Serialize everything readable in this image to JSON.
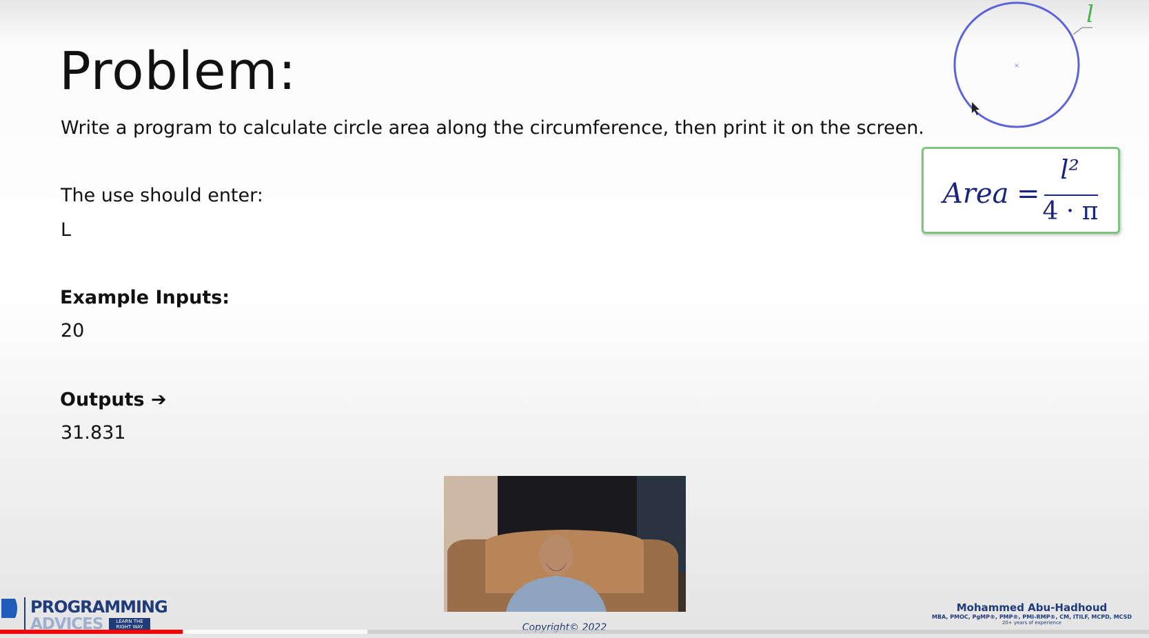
{
  "slide": {
    "title": "Problem:",
    "description": "Write a program to calculate circle area along the circumference, then print it on the screen.",
    "prompt_label": "The use should enter:",
    "prompt_value": "L",
    "example_label": "Example Inputs:",
    "example_value": "20",
    "outputs_label": "Outputs ➔",
    "outputs_value": "31.831"
  },
  "figure": {
    "circle_label": "l",
    "formula_lhs": "Area",
    "formula_eq": "=",
    "formula_num": "l²",
    "formula_den": "4 · π",
    "circle_color": "#5b63d9",
    "label_color": "#4caf50",
    "box_border_color": "#7cc47f"
  },
  "footer": {
    "copyright": "Copyright© 2022",
    "author_name": "Mohammed Abu-Hadhoud",
    "author_credentials": "MBA, PMOC, PgMP®, PMP®, PMI-RMP®, CM, ITILF, MCPD, MCSD",
    "author_experience": "20+ years of experience",
    "logo_text": "PROGRAMMING",
    "logo_subtext": "ADVICES",
    "logo_tagline": "LEARN THE RIGHT WAY"
  },
  "player": {
    "played_fraction": 0.159,
    "buffered_fraction": 0.32,
    "played_color": "#ff0000"
  }
}
